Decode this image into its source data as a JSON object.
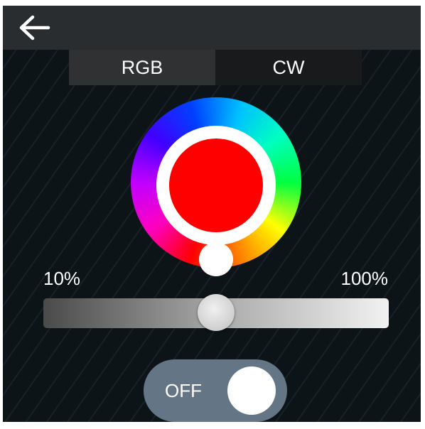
{
  "header": {
    "back_icon": "arrow-left-icon"
  },
  "tabs": [
    {
      "label": "RGB",
      "selected": true
    },
    {
      "label": "CW",
      "selected": false
    }
  ],
  "color_picker": {
    "selected_color": "#ff0000"
  },
  "brightness": {
    "min_label": "10%",
    "max_label": "100%",
    "value_fraction": 0.5
  },
  "power": {
    "label": "OFF",
    "on": false
  },
  "colors": {
    "topbar": "#2a2d30",
    "background": "#0d1418",
    "toggle": "#647585"
  }
}
